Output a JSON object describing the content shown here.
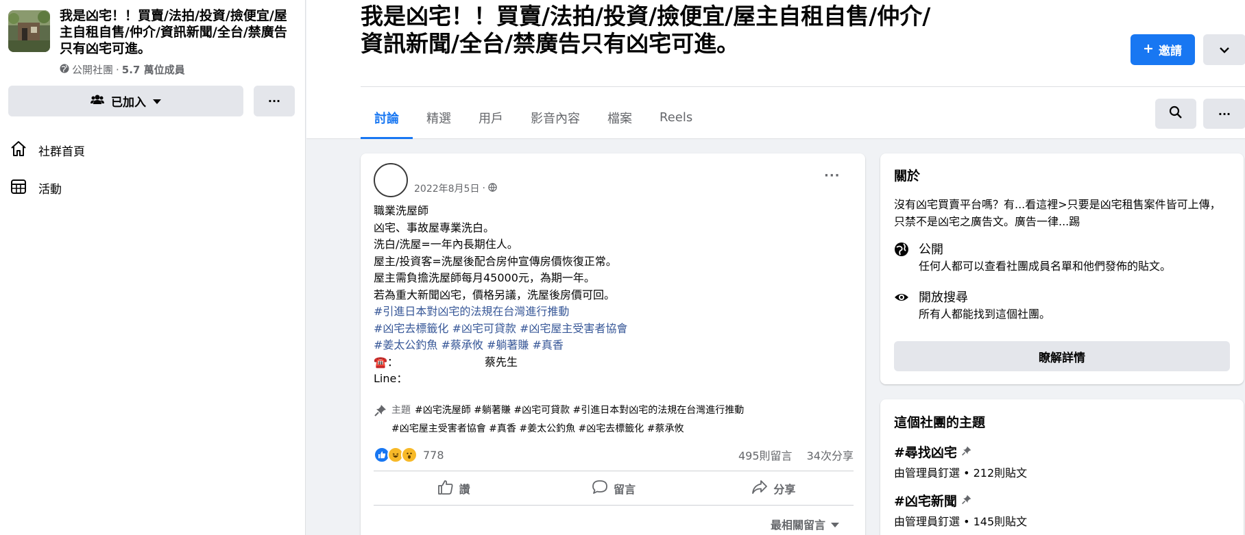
{
  "group": {
    "name": "我是凶宅！！買賣/法拍/投資/撿便宜/屋主自租自售/仲介/資訊新聞/全台/禁廣告只有凶宅可進。",
    "privacy": "公開社團",
    "members": "5.7 萬位成員",
    "joined_label": "已加入",
    "more_label": "···"
  },
  "sidebar": {
    "items": [
      {
        "label": "社群首頁",
        "icon": "home-icon"
      },
      {
        "label": "活動",
        "icon": "calendar-icon"
      }
    ]
  },
  "header": {
    "title": "我是凶宅！！買賣/法拍/投資/撿便宜/屋主自租自售/仲介/資訊新聞/全台/禁廣告只有凶宅可進。",
    "invite_label": "邀請",
    "more_label": "···",
    "tabs": [
      {
        "label": "討論",
        "active": true
      },
      {
        "label": "精選",
        "active": false
      },
      {
        "label": "用戶",
        "active": false
      },
      {
        "label": "影音內容",
        "active": false
      },
      {
        "label": "檔案",
        "active": false
      },
      {
        "label": "Reels",
        "active": false
      }
    ]
  },
  "post": {
    "date": "2022年8月5日",
    "more_label": "···",
    "lines": [
      "職業洗屋師",
      "凶宅、事故屋專業洗白。",
      "洗白/洗屋=一年內長期住人。",
      "屋主/投資客=洗屋後配合房仲宣傳房價恢復正常。",
      "屋主需負擔洗屋師每月45000元，為期一年。",
      "若為重大新聞凶宅，價格另議，洗屋後房價可回。"
    ],
    "hashtag_lines": [
      "#引進日本對凶宅的法規在台灣進行推動",
      "#凶宅去標籤化 #凶宅可貸款 #凶宅屋主受害者協會",
      "#姜太公釣魚 #蔡承攸 #躺著賺 #真香"
    ],
    "phone_prefix": "☎️：",
    "phone_name": "蔡先生",
    "line_label": "Line：",
    "topics_label": "主題",
    "topics_line1": "#凶宅洗屋師 #躺著賺 #凶宅可貸款 #引進日本對凶宅的法規在台灣進行推動",
    "topics_line2": "#凶宅屋主受害者協會 #真香 #姜太公釣魚 #凶宅去標籤化 #蔡承攸",
    "reaction_count": "778",
    "comments": "495則留言",
    "shares": "34次分享",
    "actions": {
      "like": "讚",
      "comment": "留言",
      "share": "分享"
    },
    "sort_label": "最相關留言"
  },
  "about": {
    "title": "關於",
    "description": "沒有凶宅買賣平台嗎？有...看這裡>只要是凶宅租售案件皆可上傳，只禁不是凶宅之廣告文。廣告一律...踢",
    "public_title": "公開",
    "public_desc": "任何人都可以查看社團成員名單和他們發佈的貼文。",
    "visible_title": "開放搜尋",
    "visible_desc": "所有人都能找到這個社團。",
    "details_label": "瞭解詳情"
  },
  "topics_card": {
    "title": "這個社團的主題",
    "items": [
      {
        "name": "#尋找凶宅",
        "meta": "由管理員釘選 • 212則貼文"
      },
      {
        "name": "#凶宅新聞",
        "meta": "由管理員釘選 • 145則貼文"
      }
    ]
  },
  "colors": {
    "accent": "#1877f2",
    "hashtag": "#385898",
    "background": "#f0f2f5"
  }
}
